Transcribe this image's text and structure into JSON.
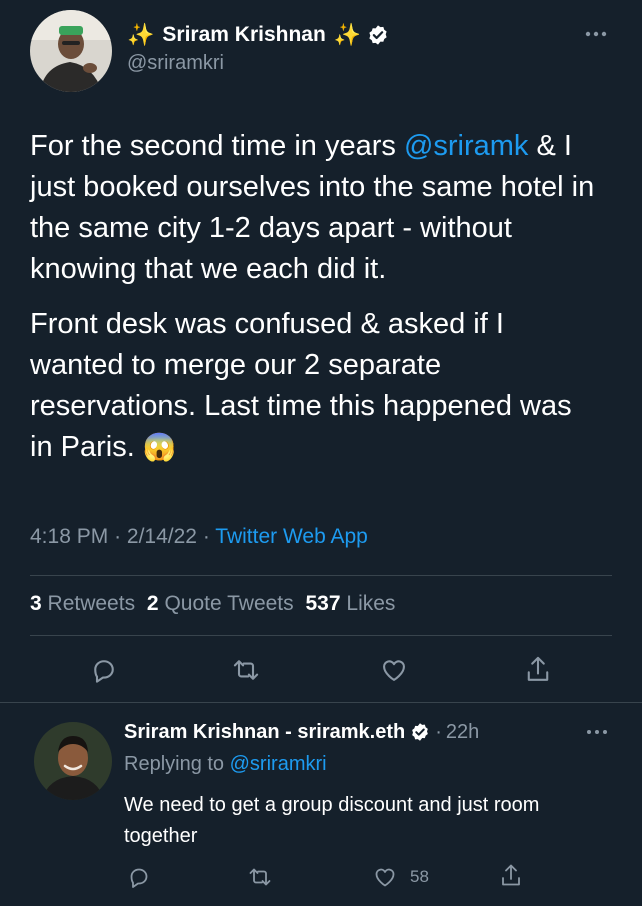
{
  "tweet": {
    "author": {
      "name": "Sriram Krishnan",
      "handle": "@sriramkri",
      "name_prefix_emoji": "✨",
      "name_suffix_emoji": "✨"
    },
    "text": {
      "p1_lead": "For the second time in years ",
      "mention": "@sriramk",
      "p1_rest": "& I just booked ourselves into the same hotel in the same city 1-2 days apart - without knowing that we each did it.",
      "p2": "Front desk was confused & asked if I wanted to merge our 2 separate reservations. Last time this happened was in Paris.",
      "emoji": "😱"
    },
    "meta": {
      "time": "4:18 PM",
      "sep1": "·",
      "date": "2/14/22",
      "sep2": "·",
      "source": "Twitter Web App"
    },
    "stats": {
      "retweets_count": "3",
      "retweets_label": "Retweets",
      "quotes_count": "2",
      "quotes_label": "Quote Tweets",
      "likes_count": "537",
      "likes_label": "Likes"
    },
    "more_icon": "more-horizontal-icon"
  },
  "reply": {
    "author": {
      "name": "Sriram Krishnan - sriramk.eth",
      "sep": "·",
      "time": "22h"
    },
    "replying_prefix": "Replying to",
    "replying_to": "@sriramkri",
    "text": "We need to get a group discount and just room together",
    "like_count": "58"
  },
  "colors": {
    "background": "#15202b",
    "text": "#ffffff",
    "muted": "#8b98a5",
    "accent": "#1d9bf0",
    "divider": "#38444d"
  }
}
